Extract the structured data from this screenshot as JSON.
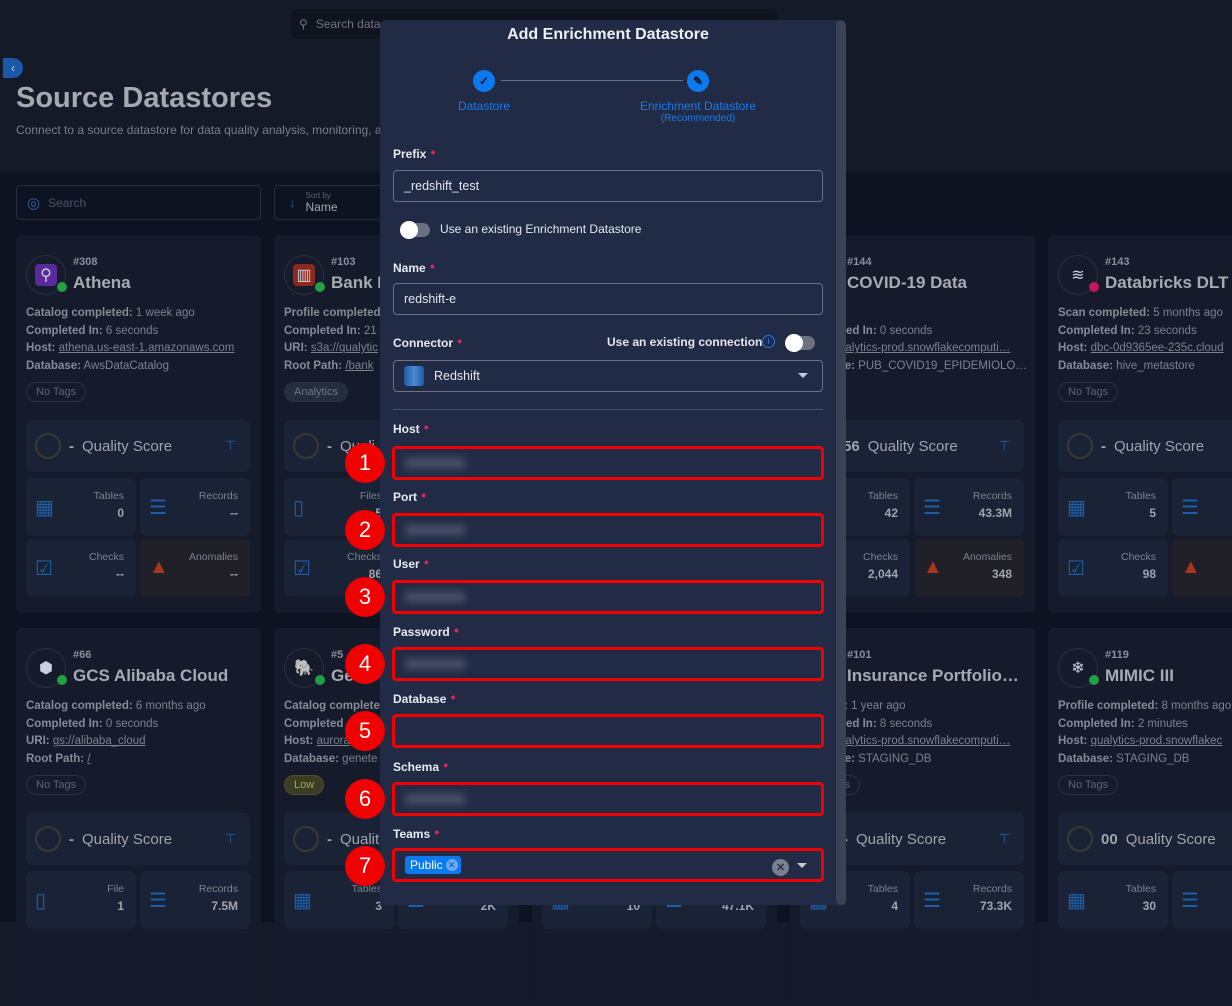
{
  "topbar": {
    "search_placeholder": "Search data"
  },
  "page": {
    "title": "Source Datastores",
    "subtitle": "Connect to a source datastore for data quality analysis, monitoring, a"
  },
  "toolbar": {
    "search_placeholder": "Search",
    "sort_label": "Sort by",
    "sort_value": "Name"
  },
  "cards": [
    {
      "col": 0,
      "row": 0,
      "id": "#308",
      "title": "Athena",
      "logo": "athena-logo",
      "logo_glyph": "⚲",
      "logo_bg": "#5a2a9c",
      "status": "#22a045",
      "lines": [
        [
          "Catalog completed:",
          "1 week ago",
          false
        ],
        [
          "Completed In:",
          "6 seconds",
          false
        ],
        [
          "Host:",
          "athena.us-east-1.amazonaws.com",
          true
        ],
        [
          "Database:",
          "AwsDataCatalog",
          false
        ]
      ],
      "tag": "No Tags",
      "tag_style": "",
      "score": "-",
      "quality_label": "Quality Score",
      "stats": [
        [
          "Tables",
          "0",
          "table-icon"
        ],
        [
          "Records",
          "--",
          "records-icon"
        ],
        [
          "Checks",
          "--",
          "checks-icon"
        ],
        [
          "Anomalies",
          "--",
          "warning-icon"
        ]
      ]
    },
    {
      "col": 1,
      "row": 0,
      "id": "#103",
      "title": "Bank D",
      "logo": "s3-logo",
      "logo_glyph": "▥",
      "logo_bg": "#8a2a1d",
      "status": "#22a045",
      "lines": [
        [
          "Profile completed",
          "",
          false
        ],
        [
          "Completed In:",
          "21",
          false
        ],
        [
          "URI:",
          "s3a://qualytic",
          true
        ],
        [
          "Root Path:",
          "/bank",
          true
        ]
      ],
      "tag": "Analytics",
      "tag_style": "analytics",
      "score": "-",
      "quality_label": "Quali",
      "stats": [
        [
          "Files",
          "5",
          "file-icon"
        ],
        null,
        [
          "Checks",
          "86",
          "checks-icon"
        ],
        null
      ]
    },
    {
      "col": 3,
      "row": 0,
      "id": "#144",
      "title": "COVID-19 Data",
      "logo": "",
      "status": "",
      "lines": [
        [
          "",
          "ago",
          false
        ],
        [
          "Completed In:",
          "0 seconds",
          false
        ],
        [
          "Host:",
          "qualytics-prod.snowflakecomputi…",
          true
        ],
        [
          "Database:",
          "PUB_COVID19_EPIDEMIOLO…",
          false
        ]
      ],
      "tag": "",
      "tag_style": "",
      "score": "56",
      "quality_label": "Quality Score",
      "stats": [
        [
          "Tables",
          "42",
          "table-icon"
        ],
        [
          "Records",
          "43.3M",
          "records-icon"
        ],
        [
          "Checks",
          "2,044",
          "checks-icon"
        ],
        [
          "Anomalies",
          "348",
          "warning-icon"
        ]
      ]
    },
    {
      "col": 4,
      "row": 0,
      "id": "#143",
      "title": "Databricks DLT",
      "logo": "databricks-logo",
      "logo_glyph": "≋",
      "logo_bg": "transparent",
      "status": "#c2185b",
      "lines": [
        [
          "Scan completed:",
          "5 months ago",
          false
        ],
        [
          "Completed In:",
          "23 seconds",
          false
        ],
        [
          "Host:",
          "dbc-0d9365ee-235c.cloud",
          true
        ],
        [
          "Database:",
          "hive_metastore",
          false
        ]
      ],
      "tag": "No Tags",
      "tag_style": "",
      "score": "-",
      "quality_label": "Quality Score",
      "stats": [
        [
          "Tables",
          "5",
          "table-icon"
        ],
        [
          "",
          "",
          "records-icon"
        ],
        [
          "Checks",
          "98",
          "checks-icon"
        ],
        [
          "An",
          "",
          "warning-icon"
        ]
      ]
    },
    {
      "col": 0,
      "row": 1,
      "id": "#66",
      "title": "GCS Alibaba Cloud",
      "logo": "alibaba-logo",
      "logo_glyph": "⬢",
      "logo_bg": "transparent",
      "status": "#22a045",
      "lines": [
        [
          "Catalog completed:",
          "6 months ago",
          false
        ],
        [
          "Completed In:",
          "0 seconds",
          false
        ],
        [
          "URI:",
          "gs://alibaba_cloud",
          true
        ],
        [
          "Root Path:",
          "/",
          true
        ]
      ],
      "tag": "No Tags",
      "tag_style": "",
      "score": "-",
      "quality_label": "Quality Score",
      "stats": [
        [
          "File",
          "1",
          "file-icon"
        ],
        [
          "Records",
          "7.5M",
          "records-icon"
        ],
        null,
        null
      ]
    },
    {
      "col": 1,
      "row": 1,
      "id": "#5",
      "title": "Gen",
      "logo": "postgres-logo",
      "logo_glyph": "🐘",
      "logo_bg": "transparent",
      "status": "#22a045",
      "lines": [
        [
          "Catalog complete",
          "",
          false
        ],
        [
          "Completed",
          "",
          false
        ],
        [
          "Host:",
          "aurora",
          true
        ],
        [
          "Database:",
          "genete",
          false
        ]
      ],
      "tag": "Low",
      "tag_style": "low",
      "score": "-",
      "quality_label": "Qualit",
      "stats": [
        [
          "Tables",
          "3",
          "table-icon"
        ],
        [
          "",
          "2K",
          "records-icon"
        ],
        null,
        null
      ]
    },
    {
      "col": 2,
      "row": 1,
      "id": "",
      "title": "",
      "logo": "",
      "status": "",
      "lines": [],
      "tag": "",
      "tag_style": "",
      "score": "",
      "quality_label": "",
      "stats": [
        [
          "",
          "10",
          "table-icon"
        ],
        [
          "",
          "47.1K",
          "records-icon"
        ],
        null,
        null
      ]
    },
    {
      "col": 3,
      "row": 1,
      "id": "#101",
      "title": "Insurance Portfolio…",
      "logo": "",
      "status": "",
      "lines": [
        [
          "mpleted:",
          "1 year ago",
          false
        ],
        [
          "Completed In:",
          "8 seconds",
          false
        ],
        [
          "Host:",
          "qualytics-prod.snowflakecomputi…",
          true
        ],
        [
          "Database:",
          "STAGING_DB",
          false
        ]
      ],
      "tag": "No Tags",
      "tag_style": "",
      "score": "-",
      "quality_label": "Quality Score",
      "stats": [
        [
          "Tables",
          "4",
          "table-icon"
        ],
        [
          "Records",
          "73.3K",
          "records-icon"
        ],
        null,
        null
      ]
    },
    {
      "col": 4,
      "row": 1,
      "id": "#119",
      "title": "MIMIC III",
      "logo": "snowflake-logo",
      "logo_glyph": "❄",
      "logo_bg": "transparent",
      "status": "#22a045",
      "lines": [
        [
          "Profile completed:",
          "8 months ago",
          false
        ],
        [
          "Completed In:",
          "2 minutes",
          false
        ],
        [
          "Host:",
          "qualytics-prod.snowflakec",
          true
        ],
        [
          "Database:",
          "STAGING_DB",
          false
        ]
      ],
      "tag": "No Tags",
      "tag_style": "",
      "score": "00",
      "quality_label": "Quality Score",
      "stats": [
        [
          "Tables",
          "30",
          "table-icon"
        ],
        [
          "",
          "",
          "records-icon"
        ],
        null,
        null
      ]
    }
  ],
  "modal": {
    "title": "Add Enrichment Datastore",
    "steps": [
      {
        "label": "Datastore",
        "state": "done"
      },
      {
        "label": "Enrichment Datastore",
        "sub": "(Recommended)",
        "state": "active"
      }
    ],
    "prefix": {
      "label": "Prefix",
      "value": "_redshift_test"
    },
    "use_existing_enrichment": {
      "label": "Use an existing Enrichment Datastore",
      "on": false
    },
    "name": {
      "label": "Name",
      "value": "redshift-e"
    },
    "connector": {
      "label": "Connector",
      "value": "Redshift",
      "existing_label": "Use an existing connection",
      "existing_on": false
    },
    "fields": [
      {
        "label": "Host",
        "marker": "1",
        "redacted": true
      },
      {
        "label": "Port",
        "marker": "2",
        "redacted": true
      },
      {
        "label": "User",
        "marker": "3",
        "redacted": true
      },
      {
        "label": "Password",
        "marker": "4",
        "redacted": true
      },
      {
        "label": "Database",
        "marker": "5",
        "redacted": false
      },
      {
        "label": "Schema",
        "marker": "6",
        "redacted": true
      }
    ],
    "teams": {
      "label": "Teams",
      "marker": "7",
      "chips": [
        "Public"
      ]
    }
  },
  "colors": {
    "accent": "#0b79f0",
    "highlight": "#f00000",
    "required": "#e0245e"
  }
}
